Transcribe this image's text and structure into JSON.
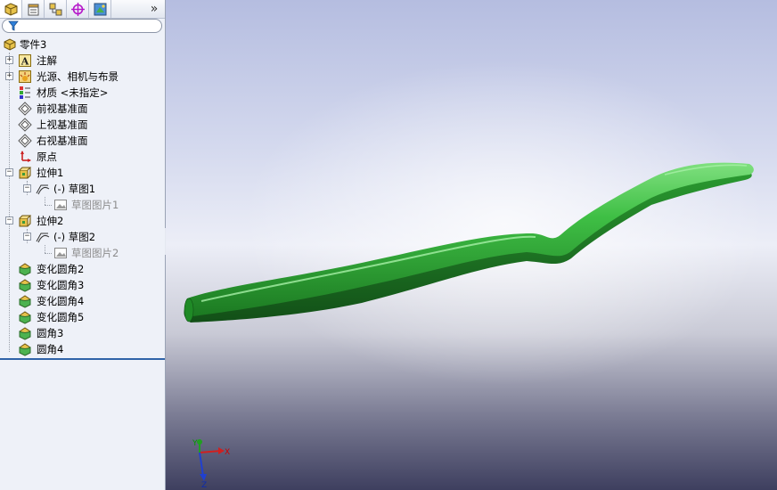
{
  "panel": {
    "tabs": [
      {
        "icon": "feature-manager-icon",
        "active": true
      },
      {
        "icon": "property-manager-icon",
        "active": false
      },
      {
        "icon": "configuration-manager-icon",
        "active": false
      },
      {
        "icon": "dimxpert-manager-icon",
        "active": false
      },
      {
        "icon": "display-manager-icon",
        "active": false
      }
    ],
    "more_label": "»",
    "filter": {
      "icon": "filter-icon",
      "value": ""
    }
  },
  "tree": {
    "root": "零件3",
    "items": [
      {
        "label": "注解",
        "icon": "annotations-icon"
      },
      {
        "label": "光源、相机与布景",
        "icon": "lights-cameras-icon"
      },
      {
        "label": "材质 <未指定>",
        "icon": "material-icon"
      },
      {
        "label": "前视基准面",
        "icon": "plane-icon"
      },
      {
        "label": "上视基准面",
        "icon": "plane-icon"
      },
      {
        "label": "右视基准面",
        "icon": "plane-icon"
      },
      {
        "label": "原点",
        "icon": "origin-icon"
      },
      {
        "label": "拉伸1",
        "icon": "extrude-icon"
      },
      {
        "label": "(-) 草图1",
        "icon": "sketch-icon"
      },
      {
        "label": "草图图片1",
        "icon": "sketch-picture-icon"
      },
      {
        "label": "拉伸2",
        "icon": "extrude-icon"
      },
      {
        "label": "(-) 草图2",
        "icon": "sketch-icon"
      },
      {
        "label": "草图图片2",
        "icon": "sketch-picture-icon"
      },
      {
        "label": "变化圆角2",
        "icon": "fillet-icon"
      },
      {
        "label": "变化圆角3",
        "icon": "fillet-icon"
      },
      {
        "label": "变化圆角4",
        "icon": "fillet-icon"
      },
      {
        "label": "变化圆角5",
        "icon": "fillet-icon"
      },
      {
        "label": "圆角3",
        "icon": "fillet-icon"
      },
      {
        "label": "圆角4",
        "icon": "fillet-icon"
      }
    ]
  },
  "viewport": {
    "part_color": "#3fbf45",
    "triad": {
      "x_label": "X",
      "y_label": "Y",
      "z_label": "Z"
    }
  }
}
